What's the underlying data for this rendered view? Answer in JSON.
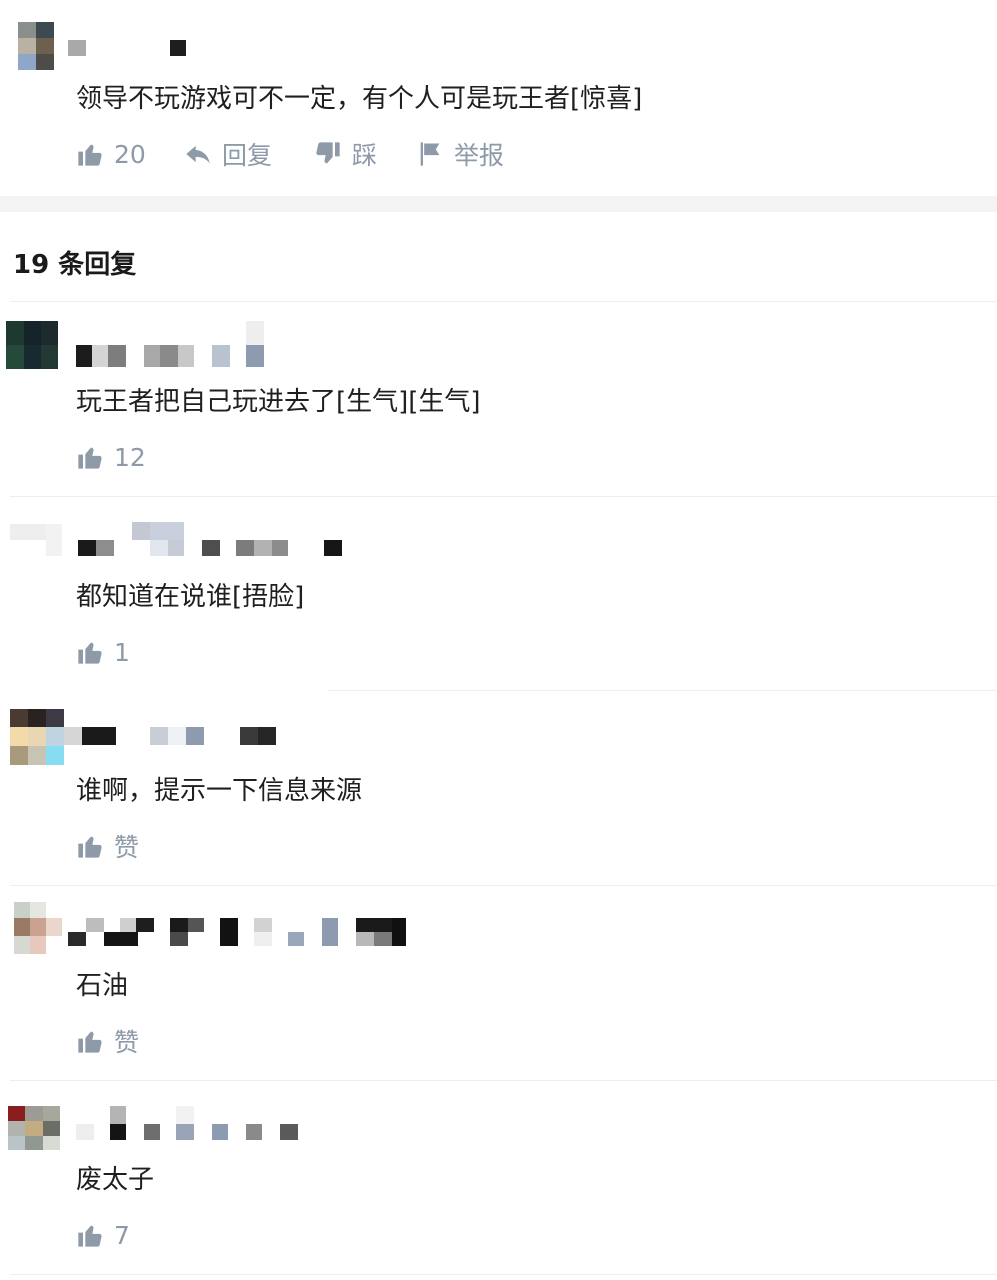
{
  "main_comment": {
    "text": "领导不玩游戏可不一定，有个人可是玩王者[惊喜]",
    "like_count": "20",
    "reply_label": "回复",
    "dislike_label": "踩",
    "report_label": "举报"
  },
  "replies_header": {
    "title": "19 条回复"
  },
  "replies": [
    {
      "text": "玩王者把自己玩进去了[生气][生气]",
      "like_label": "12"
    },
    {
      "text": "都知道在说谁[捂脸]",
      "like_label": "1"
    },
    {
      "text": "谁啊，提示一下信息来源",
      "like_label": "赞"
    },
    {
      "text": "石油",
      "like_label": "赞"
    },
    {
      "text": "废太子",
      "like_label": "7"
    }
  ],
  "colors": {
    "action_gray": "#8e9aa8",
    "text_dark": "#1f1f1f",
    "divider": "#eeeeee",
    "band": "#f4f4f4"
  },
  "icons": [
    "thumbs-up-icon",
    "reply-arrow-icon",
    "thumbs-down-icon",
    "flag-icon"
  ]
}
